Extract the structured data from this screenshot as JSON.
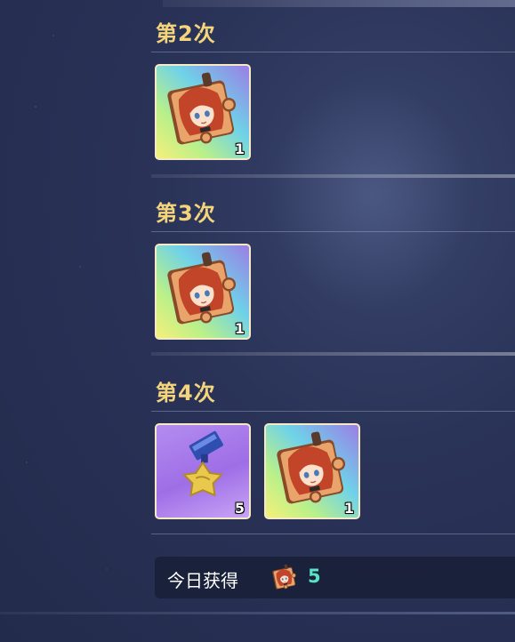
{
  "sections": [
    {
      "title": "第2次",
      "rewards": [
        {
          "icon": "character-puzzle-piece-icon",
          "quantity": "1"
        }
      ]
    },
    {
      "title": "第3次",
      "rewards": [
        {
          "icon": "character-puzzle-piece-icon",
          "quantity": "1"
        }
      ]
    },
    {
      "title": "第4次",
      "rewards": [
        {
          "icon": "star-medal-icon",
          "quantity": "5"
        },
        {
          "icon": "character-puzzle-piece-icon",
          "quantity": "1"
        }
      ]
    }
  ],
  "footer": {
    "label": "今日获得",
    "icon": "character-puzzle-piece-icon",
    "count": "5"
  },
  "colors": {
    "title": "#f4d57b",
    "count": "#58e3c6"
  }
}
